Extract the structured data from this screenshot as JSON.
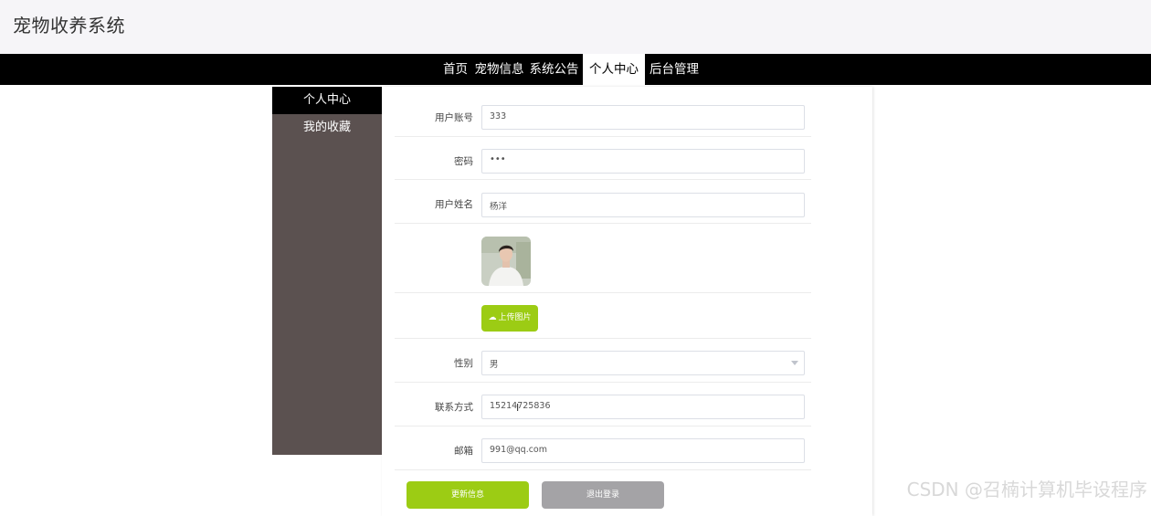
{
  "header": {
    "title": "宠物收养系统"
  },
  "nav": {
    "items": [
      {
        "label": "首页"
      },
      {
        "label": "宠物信息"
      },
      {
        "label": "系统公告"
      },
      {
        "label": "个人中心"
      },
      {
        "label": "后台管理"
      }
    ],
    "active": "个人中心"
  },
  "sidebar": {
    "items": [
      {
        "label": "个人中心"
      },
      {
        "label": "我的收藏"
      }
    ],
    "active": "个人中心"
  },
  "form": {
    "account_label": "用户账号",
    "account_value": "333",
    "password_label": "密码",
    "password_value": "•••",
    "name_label": "用户姓名",
    "name_value": "杨洋",
    "upload_label": "上传图片",
    "upload_icon": "cloud-upload-icon",
    "gender_label": "性别",
    "gender_value": "男",
    "phone_label": "联系方式",
    "phone_value": "15214725836",
    "email_label": "邮箱",
    "email_value": "991@qq.com"
  },
  "actions": {
    "update_label": "更新信息",
    "logout_label": "退出登录"
  },
  "watermark": "CSDN @召楠计算机毕设程序",
  "colors": {
    "accent_green": "#9ccc14",
    "gray_button": "#a4a3a6",
    "navbar": "#000000",
    "sidebar": "#5b5150"
  }
}
